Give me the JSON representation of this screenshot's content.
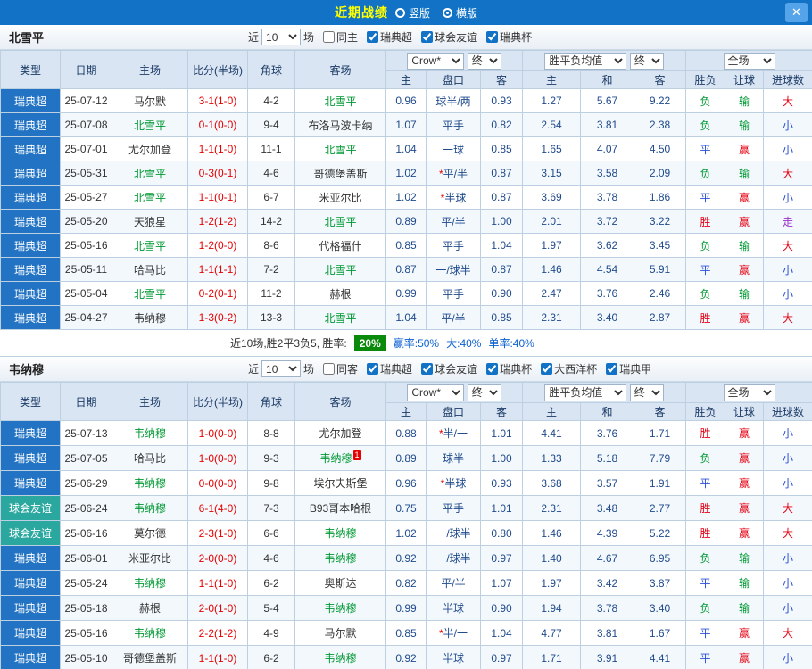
{
  "topbar": {
    "title": "近期战绩",
    "layout_options": [
      {
        "label": "竖版",
        "selected": false
      },
      {
        "label": "横版",
        "selected": true
      }
    ],
    "close": "✕"
  },
  "controls": {
    "near": "近",
    "games": "场",
    "odds_source": "Crow*",
    "final": "终",
    "avg": "胜平负均值",
    "scope": "全场"
  },
  "columns": {
    "type": "类型",
    "date": "日期",
    "home": "主场",
    "score": "比分(半场)",
    "corner": "角球",
    "away": "客场",
    "sub": [
      "主",
      "盘口",
      "客",
      "主",
      "和",
      "客",
      "胜负",
      "让球",
      "进球数"
    ]
  },
  "colors": {
    "league_blue": "#2273c3",
    "league_teal": "#2aa79f",
    "win": "#e60012",
    "draw": "#2a4fd8",
    "lose": "#009933",
    "push": "#9933cc",
    "focus_team": "#009933",
    "score": "#e60000",
    "win_rate_badge": "#0a8a0a"
  },
  "sections": [
    {
      "team": "北雪平",
      "filter": {
        "near_value": "10",
        "checks": [
          {
            "label": "同主",
            "checked": false
          },
          {
            "label": "瑞典超",
            "checked": true
          },
          {
            "label": "球会友谊",
            "checked": true
          },
          {
            "label": "瑞典杯",
            "checked": true
          }
        ]
      },
      "rows": [
        {
          "league": "瑞典超",
          "lc": "sw",
          "date": "25-07-12",
          "home": "马尔默",
          "hf": false,
          "score": "3-1(1-0)",
          "corner": "4-2",
          "away": "北雪平",
          "af": true,
          "o": [
            "0.96",
            "球半/两",
            "0.93"
          ],
          "a": [
            "1.27",
            "5.67",
            "9.22"
          ],
          "r": [
            [
              "负",
              "g"
            ],
            [
              "输",
              "g"
            ],
            [
              "大",
              "r"
            ]
          ]
        },
        {
          "league": "瑞典超",
          "lc": "sw",
          "date": "25-07-08",
          "home": "北雪平",
          "hf": true,
          "score": "0-1(0-0)",
          "corner": "9-4",
          "away": "布洛马波卡纳",
          "af": false,
          "o": [
            "1.07",
            "平手",
            "0.82"
          ],
          "a": [
            "2.54",
            "3.81",
            "2.38"
          ],
          "r": [
            [
              "负",
              "g"
            ],
            [
              "输",
              "g"
            ],
            [
              "小",
              "b"
            ]
          ]
        },
        {
          "league": "瑞典超",
          "lc": "sw",
          "date": "25-07-01",
          "home": "尤尔加登",
          "hf": false,
          "score": "1-1(1-0)",
          "corner": "11-1",
          "away": "北雪平",
          "af": true,
          "o": [
            "1.04",
            "一球",
            "0.85"
          ],
          "a": [
            "1.65",
            "4.07",
            "4.50"
          ],
          "r": [
            [
              "平",
              "b"
            ],
            [
              "赢",
              "r"
            ],
            [
              "小",
              "b"
            ]
          ]
        },
        {
          "league": "瑞典超",
          "lc": "sw",
          "date": "25-05-31",
          "home": "北雪平",
          "hf": true,
          "score": "0-3(0-1)",
          "corner": "4-6",
          "away": "哥德堡盖斯",
          "af": false,
          "o": [
            "1.02",
            "*平/半",
            "0.87"
          ],
          "a": [
            "3.15",
            "3.58",
            "2.09"
          ],
          "r": [
            [
              "负",
              "g"
            ],
            [
              "输",
              "g"
            ],
            [
              "大",
              "r"
            ]
          ]
        },
        {
          "league": "瑞典超",
          "lc": "sw",
          "date": "25-05-27",
          "home": "北雪平",
          "hf": true,
          "score": "1-1(0-1)",
          "corner": "6-7",
          "away": "米亚尔比",
          "af": false,
          "o": [
            "1.02",
            "*半球",
            "0.87"
          ],
          "a": [
            "3.69",
            "3.78",
            "1.86"
          ],
          "r": [
            [
              "平",
              "b"
            ],
            [
              "赢",
              "r"
            ],
            [
              "小",
              "b"
            ]
          ]
        },
        {
          "league": "瑞典超",
          "lc": "sw",
          "date": "25-05-20",
          "home": "天狼星",
          "hf": false,
          "score": "1-2(1-2)",
          "corner": "14-2",
          "away": "北雪平",
          "af": true,
          "o": [
            "0.89",
            "平/半",
            "1.00"
          ],
          "a": [
            "2.01",
            "3.72",
            "3.22"
          ],
          "r": [
            [
              "胜",
              "r"
            ],
            [
              "赢",
              "r"
            ],
            [
              "走",
              "p"
            ]
          ]
        },
        {
          "league": "瑞典超",
          "lc": "sw",
          "date": "25-05-16",
          "home": "北雪平",
          "hf": true,
          "score": "1-2(0-0)",
          "corner": "8-6",
          "away": "代格福什",
          "af": false,
          "o": [
            "0.85",
            "平手",
            "1.04"
          ],
          "a": [
            "1.97",
            "3.62",
            "3.45"
          ],
          "r": [
            [
              "负",
              "g"
            ],
            [
              "输",
              "g"
            ],
            [
              "大",
              "r"
            ]
          ]
        },
        {
          "league": "瑞典超",
          "lc": "sw",
          "date": "25-05-11",
          "home": "哈马比",
          "hf": false,
          "score": "1-1(1-1)",
          "corner": "7-2",
          "away": "北雪平",
          "af": true,
          "o": [
            "0.87",
            "一/球半",
            "0.87"
          ],
          "a": [
            "1.46",
            "4.54",
            "5.91"
          ],
          "r": [
            [
              "平",
              "b"
            ],
            [
              "赢",
              "r"
            ],
            [
              "小",
              "b"
            ]
          ]
        },
        {
          "league": "瑞典超",
          "lc": "sw",
          "date": "25-05-04",
          "home": "北雪平",
          "hf": true,
          "score": "0-2(0-1)",
          "corner": "11-2",
          "away": "赫根",
          "af": false,
          "o": [
            "0.99",
            "平手",
            "0.90"
          ],
          "a": [
            "2.47",
            "3.76",
            "2.46"
          ],
          "r": [
            [
              "负",
              "g"
            ],
            [
              "输",
              "g"
            ],
            [
              "小",
              "b"
            ]
          ]
        },
        {
          "league": "瑞典超",
          "lc": "sw",
          "date": "25-04-27",
          "home": "韦纳穆",
          "hf": false,
          "score": "1-3(0-2)",
          "corner": "13-3",
          "away": "北雪平",
          "af": true,
          "o": [
            "1.04",
            "平/半",
            "0.85"
          ],
          "a": [
            "2.31",
            "3.40",
            "2.87"
          ],
          "r": [
            [
              "胜",
              "r"
            ],
            [
              "赢",
              "r"
            ],
            [
              "大",
              "r"
            ]
          ]
        }
      ],
      "summary": {
        "record": "近10场,胜2平3负5, 胜率:",
        "win_rate": "20%",
        "win_odds_rate": "赢率:50%",
        "big_rate": "大:40%",
        "single_rate": "单率:40%"
      }
    },
    {
      "team": "韦纳穆",
      "filter": {
        "near_value": "10",
        "checks": [
          {
            "label": "同客",
            "checked": false
          },
          {
            "label": "瑞典超",
            "checked": true
          },
          {
            "label": "球会友谊",
            "checked": true
          },
          {
            "label": "瑞典杯",
            "checked": true
          },
          {
            "label": "大西洋杯",
            "checked": true
          },
          {
            "label": "瑞典甲",
            "checked": true
          }
        ]
      },
      "rows": [
        {
          "league": "瑞典超",
          "lc": "sw",
          "date": "25-07-13",
          "home": "韦纳穆",
          "hf": true,
          "score": "1-0(0-0)",
          "corner": "8-8",
          "away": "尤尔加登",
          "af": false,
          "o": [
            "0.88",
            "*半/一",
            "1.01"
          ],
          "a": [
            "4.41",
            "3.76",
            "1.71"
          ],
          "r": [
            [
              "胜",
              "r"
            ],
            [
              "赢",
              "r"
            ],
            [
              "小",
              "b"
            ]
          ]
        },
        {
          "league": "瑞典超",
          "lc": "sw",
          "date": "25-07-05",
          "home": "哈马比",
          "hf": false,
          "score": "1-0(0-0)",
          "corner": "9-3",
          "away": "韦纳穆",
          "af": true,
          "ac": "1",
          "o": [
            "0.89",
            "球半",
            "1.00"
          ],
          "a": [
            "1.33",
            "5.18",
            "7.79"
          ],
          "r": [
            [
              "负",
              "g"
            ],
            [
              "赢",
              "r"
            ],
            [
              "小",
              "b"
            ]
          ]
        },
        {
          "league": "瑞典超",
          "lc": "sw",
          "date": "25-06-29",
          "home": "韦纳穆",
          "hf": true,
          "score": "0-0(0-0)",
          "corner": "9-8",
          "away": "埃尔夫斯堡",
          "af": false,
          "o": [
            "0.96",
            "*半球",
            "0.93"
          ],
          "a": [
            "3.68",
            "3.57",
            "1.91"
          ],
          "r": [
            [
              "平",
              "b"
            ],
            [
              "赢",
              "r"
            ],
            [
              "小",
              "b"
            ]
          ]
        },
        {
          "league": "球会友谊",
          "lc": "fr",
          "date": "25-06-24",
          "home": "韦纳穆",
          "hf": true,
          "score": "6-1(4-0)",
          "corner": "7-3",
          "away": "B93哥本哈根",
          "af": false,
          "o": [
            "0.75",
            "平手",
            "1.01"
          ],
          "a": [
            "2.31",
            "3.48",
            "2.77"
          ],
          "r": [
            [
              "胜",
              "r"
            ],
            [
              "赢",
              "r"
            ],
            [
              "大",
              "r"
            ]
          ]
        },
        {
          "league": "球会友谊",
          "lc": "fr",
          "date": "25-06-16",
          "home": "莫尔德",
          "hf": false,
          "score": "2-3(1-0)",
          "corner": "6-6",
          "away": "韦纳穆",
          "af": true,
          "o": [
            "1.02",
            "一/球半",
            "0.80"
          ],
          "a": [
            "1.46",
            "4.39",
            "5.22"
          ],
          "r": [
            [
              "胜",
              "r"
            ],
            [
              "赢",
              "r"
            ],
            [
              "大",
              "r"
            ]
          ]
        },
        {
          "league": "瑞典超",
          "lc": "sw",
          "date": "25-06-01",
          "home": "米亚尔比",
          "hf": false,
          "score": "2-0(0-0)",
          "corner": "4-6",
          "away": "韦纳穆",
          "af": true,
          "o": [
            "0.92",
            "一/球半",
            "0.97"
          ],
          "a": [
            "1.40",
            "4.67",
            "6.95"
          ],
          "r": [
            [
              "负",
              "g"
            ],
            [
              "输",
              "g"
            ],
            [
              "小",
              "b"
            ]
          ]
        },
        {
          "league": "瑞典超",
          "lc": "sw",
          "date": "25-05-24",
          "home": "韦纳穆",
          "hf": true,
          "score": "1-1(1-0)",
          "corner": "6-2",
          "away": "奥斯达",
          "af": false,
          "o": [
            "0.82",
            "平/半",
            "1.07"
          ],
          "a": [
            "1.97",
            "3.42",
            "3.87"
          ],
          "r": [
            [
              "平",
              "b"
            ],
            [
              "输",
              "g"
            ],
            [
              "小",
              "b"
            ]
          ]
        },
        {
          "league": "瑞典超",
          "lc": "sw",
          "date": "25-05-18",
          "home": "赫根",
          "hf": false,
          "score": "2-0(1-0)",
          "corner": "5-4",
          "away": "韦纳穆",
          "af": true,
          "o": [
            "0.99",
            "半球",
            "0.90"
          ],
          "a": [
            "1.94",
            "3.78",
            "3.40"
          ],
          "r": [
            [
              "负",
              "g"
            ],
            [
              "输",
              "g"
            ],
            [
              "小",
              "b"
            ]
          ]
        },
        {
          "league": "瑞典超",
          "lc": "sw",
          "date": "25-05-16",
          "home": "韦纳穆",
          "hf": true,
          "score": "2-2(1-2)",
          "corner": "4-9",
          "away": "马尔默",
          "af": false,
          "o": [
            "0.85",
            "*半/一",
            "1.04"
          ],
          "a": [
            "4.77",
            "3.81",
            "1.67"
          ],
          "r": [
            [
              "平",
              "b"
            ],
            [
              "赢",
              "r"
            ],
            [
              "大",
              "r"
            ]
          ]
        },
        {
          "league": "瑞典超",
          "lc": "sw",
          "date": "25-05-10",
          "home": "哥德堡盖斯",
          "hf": false,
          "score": "1-1(1-0)",
          "corner": "6-2",
          "away": "韦纳穆",
          "af": true,
          "o": [
            "0.92",
            "半球",
            "0.97"
          ],
          "a": [
            "1.71",
            "3.91",
            "4.41"
          ],
          "r": [
            [
              "平",
              "b"
            ],
            [
              "赢",
              "r"
            ],
            [
              "小",
              "b"
            ]
          ]
        }
      ]
    }
  ]
}
